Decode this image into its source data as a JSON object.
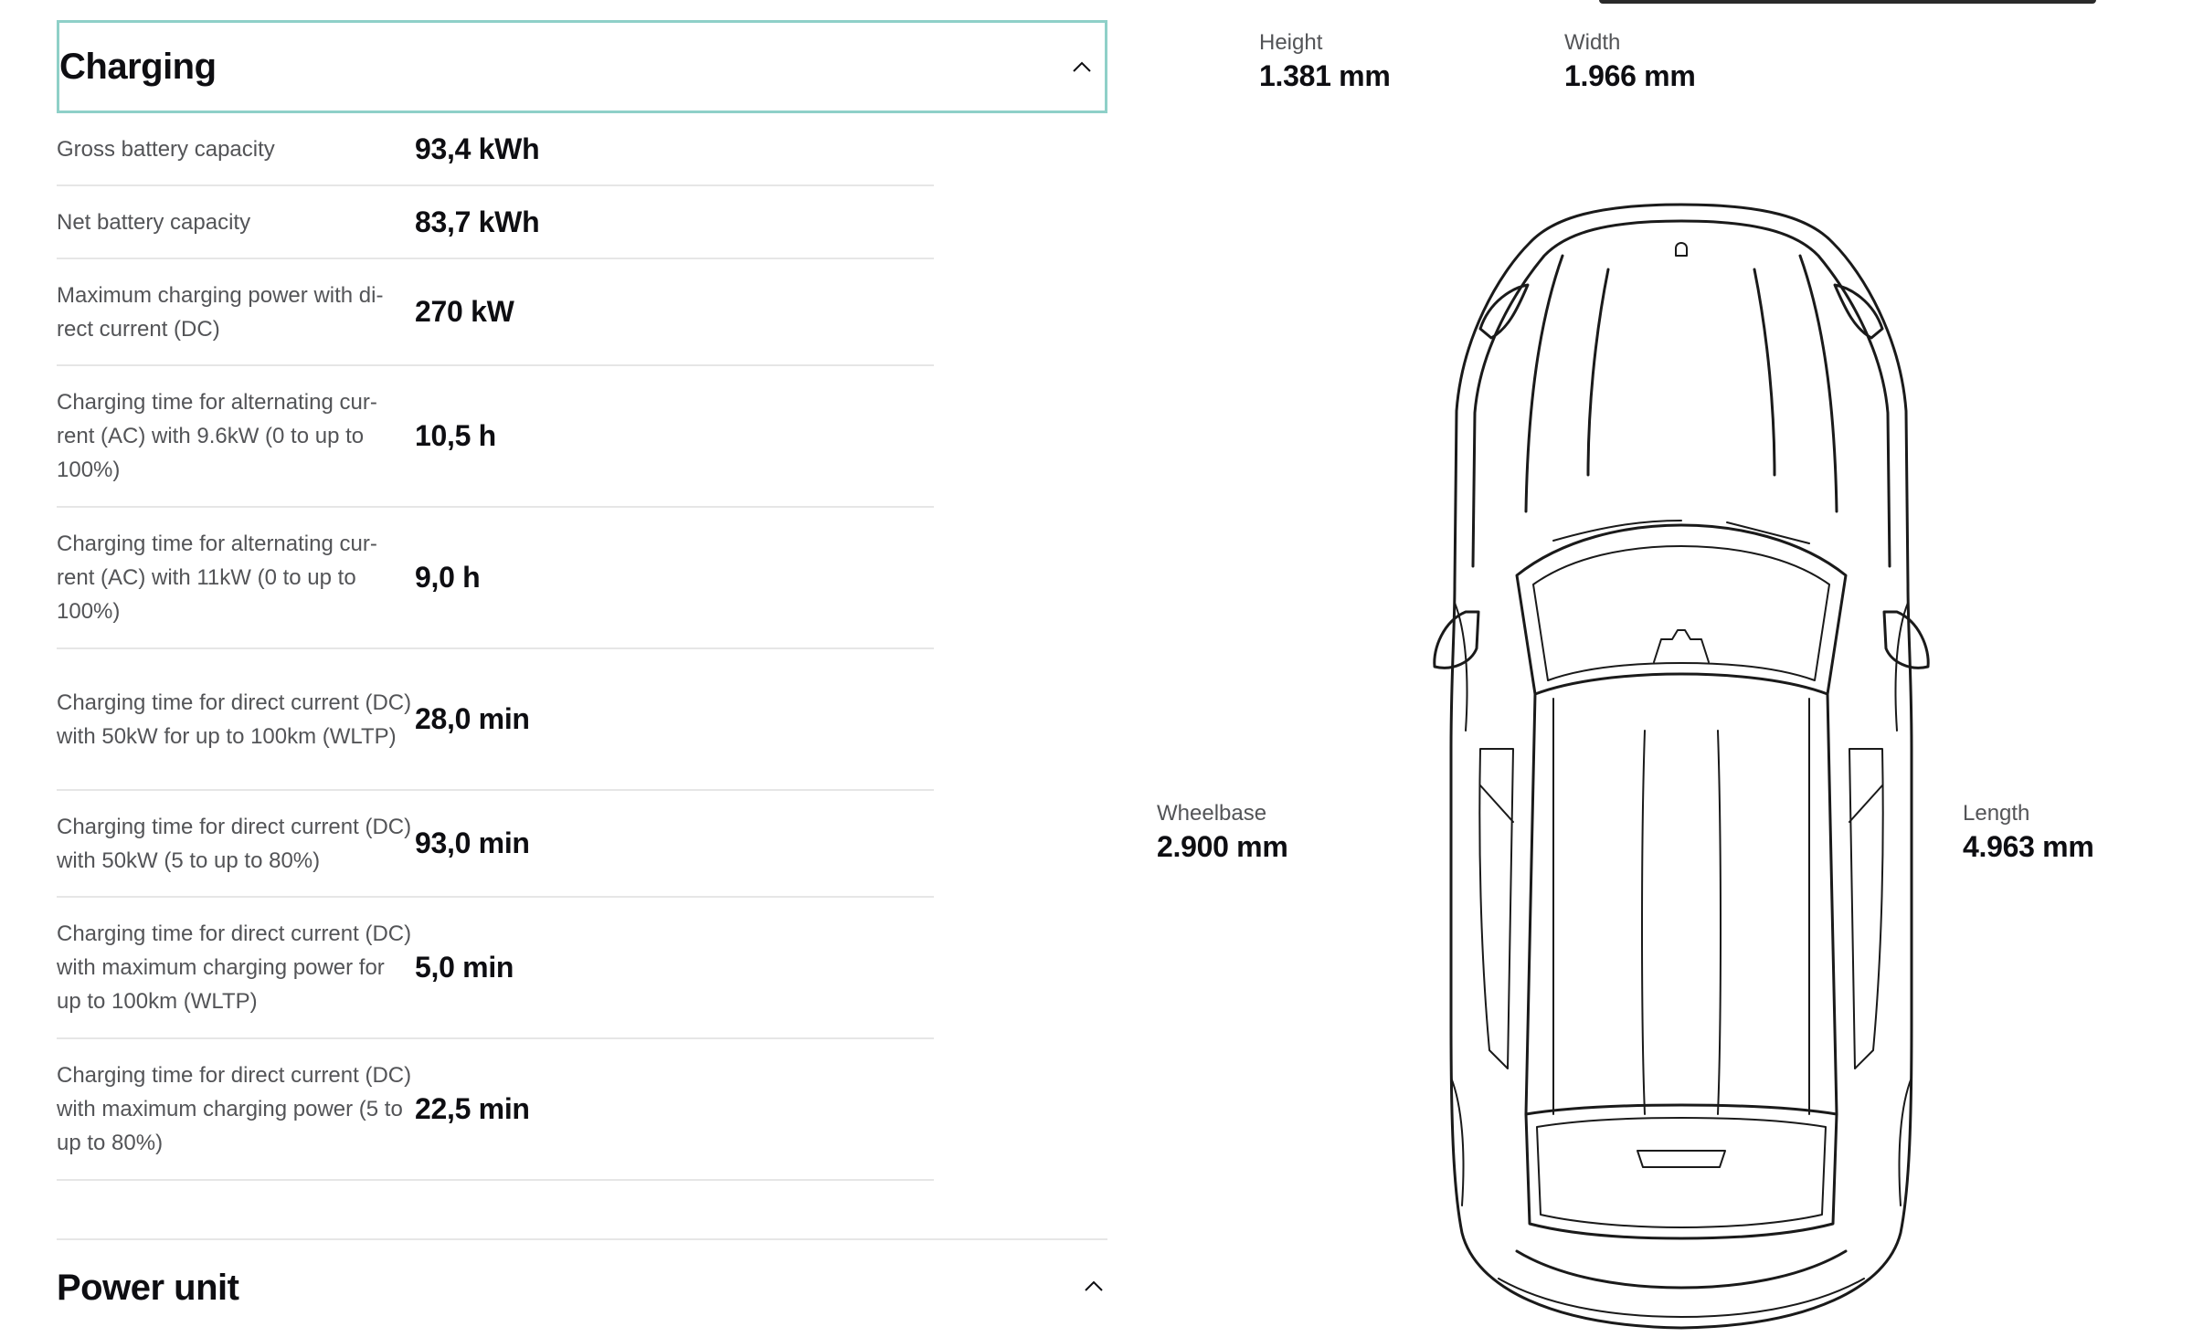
{
  "charging": {
    "title": "Charging",
    "rows": [
      {
        "label": "Gross battery capacity",
        "value": "93,4 kWh"
      },
      {
        "label": "Net battery capacity",
        "value": "83,7 kWh"
      },
      {
        "label": "Maximum charging power with di-rect current (DC)",
        "value": "270 kW"
      },
      {
        "label": "Charging time for alternating cur-rent (AC) with 9.6kW (0 to up to 100%)",
        "value": "10,5 h"
      },
      {
        "label": "Charging time for alternating cur-rent (AC) with 11kW (0 to up to 100%)",
        "value": "9,0 h"
      },
      {
        "label": "Charging time for direct current (DC) with 50kW for up to 100km (WLTP)",
        "value": "28,0 min"
      },
      {
        "label": "Charging time for direct current (DC) with 50kW (5 to up to 80%)",
        "value": "93,0 min"
      },
      {
        "label": "Charging time for direct current (DC) with maximum charging power for up to 100km (WLTP)",
        "value": "5,0 min"
      },
      {
        "label": "Charging time for direct current (DC) with maximum charging power (5 to up to 80%)",
        "value": "22,5 min"
      }
    ]
  },
  "power_unit": {
    "title": "Power unit"
  },
  "dimensions": {
    "height": {
      "label": "Height",
      "value": "1.381 mm"
    },
    "width": {
      "label": "Width",
      "value": "1.966 mm"
    },
    "wheelbase": {
      "label": "Wheelbase",
      "value": "2.900 mm"
    },
    "length": {
      "label": "Length",
      "value": "4.963 mm"
    }
  },
  "icons": {
    "collapse_charging": "chevron-up-icon",
    "collapse_power": "chevron-up-icon",
    "car": "car-top-view-illustration"
  },
  "colors": {
    "focus_border": "#8fd0c8",
    "text_primary": "#0e0e12",
    "text_secondary": "#535457",
    "divider": "#e6e6e6"
  }
}
